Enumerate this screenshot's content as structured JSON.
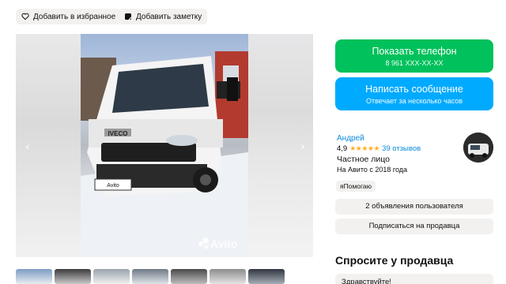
{
  "actions": {
    "favorite_label": "Добавить в избранное",
    "note_label": "Добавить заметку"
  },
  "gallery": {
    "watermark": "Avito",
    "brand_badge": "IVECO",
    "plate_text": "Avito",
    "prev_icon": "chevron-left-icon",
    "next_icon": "chevron-right-icon",
    "thumbnail_count": 7
  },
  "contact": {
    "phone_button": {
      "label": "Показать телефон",
      "sub": "8 961 XXX-XX-XX",
      "color": "#00c15b"
    },
    "message_button": {
      "label": "Написать сообщение",
      "sub": "Отвечает за несколько часов",
      "color": "#00aaff"
    }
  },
  "seller": {
    "name": "Андрей",
    "rating": "4,9",
    "stars": "★★★★★",
    "reviews": "39 отзывов",
    "type": "Частное лицо",
    "since": "На Авито с 2018 года",
    "tag": "яПомогаю",
    "listings_button": "2 объявления пользователя",
    "subscribe_button": "Подписаться на продавца"
  },
  "ask": {
    "title": "Спросите у продавца",
    "quick_reply": "Здравствуйте!"
  }
}
